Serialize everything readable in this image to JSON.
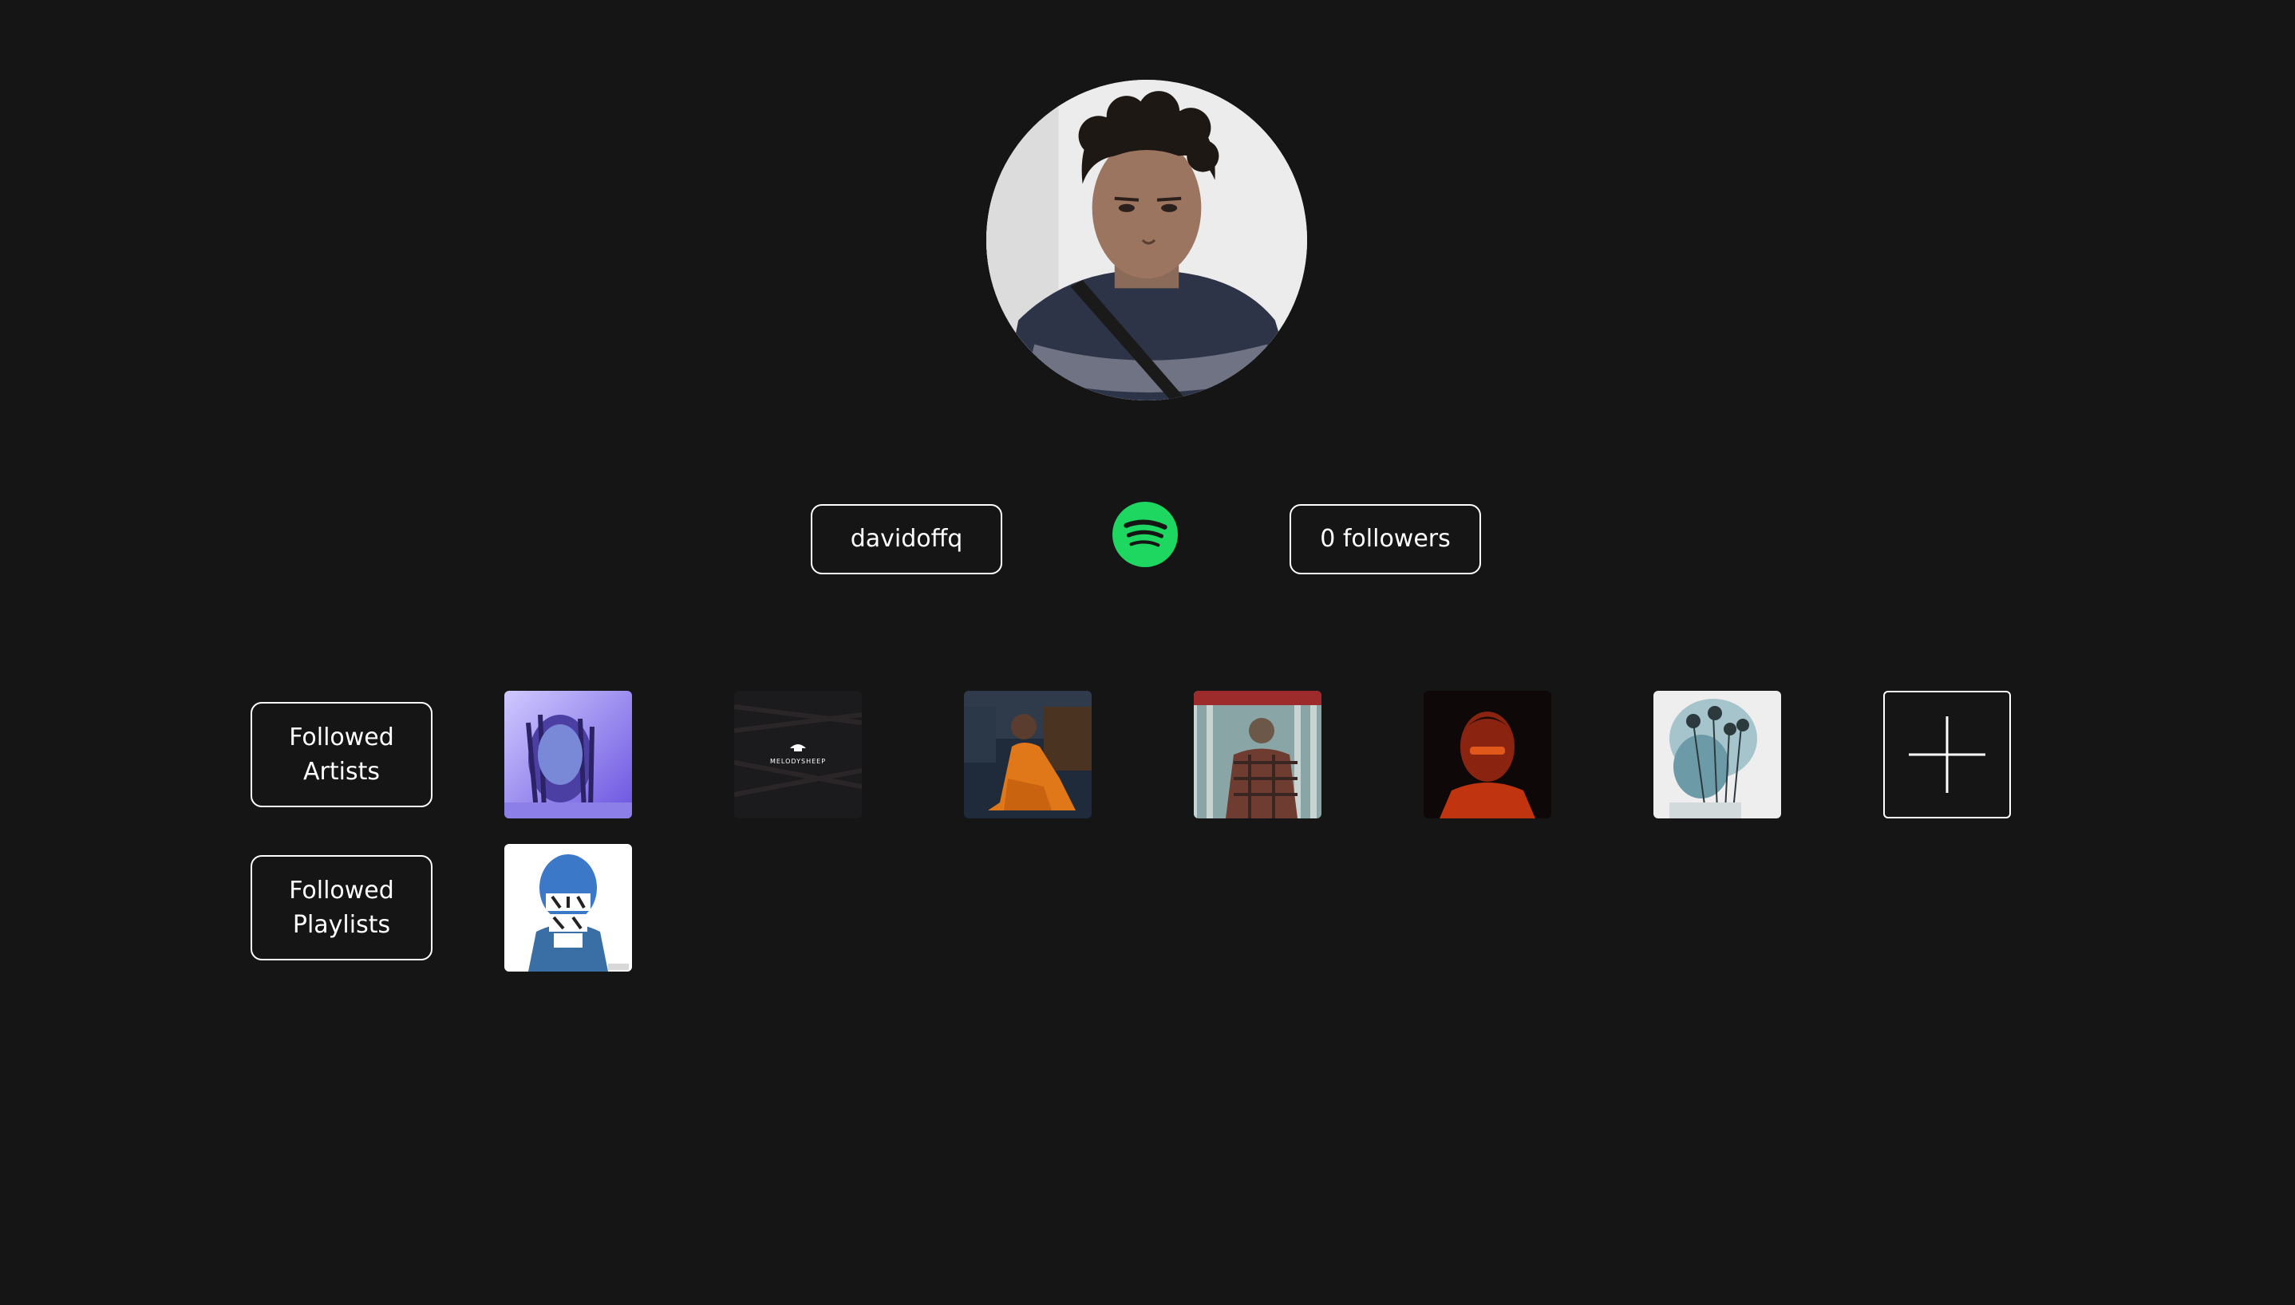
{
  "profile": {
    "username": "davidoffq",
    "followers_label": "0 followers",
    "avatar_icon": "profile-photo",
    "logo_icon": "spotify-logo",
    "logo_color": "#1ed760"
  },
  "sections": {
    "artists": {
      "line1": "Followed",
      "line2": "Artists"
    },
    "playlists": {
      "line1": "Followed",
      "line2": "Playlists"
    }
  },
  "artists_tiles": [
    {
      "icon": "artist-cover-1"
    },
    {
      "icon": "artist-cover-2",
      "caption": "MELODYSHEEP"
    },
    {
      "icon": "artist-cover-3"
    },
    {
      "icon": "artist-cover-4"
    },
    {
      "icon": "artist-cover-5"
    },
    {
      "icon": "artist-cover-6"
    }
  ],
  "playlist_tiles": [
    {
      "icon": "playlist-cover-1"
    }
  ],
  "add_button_icon": "plus-icon",
  "colors": {
    "background": "#151515",
    "border": "#ffffff"
  }
}
